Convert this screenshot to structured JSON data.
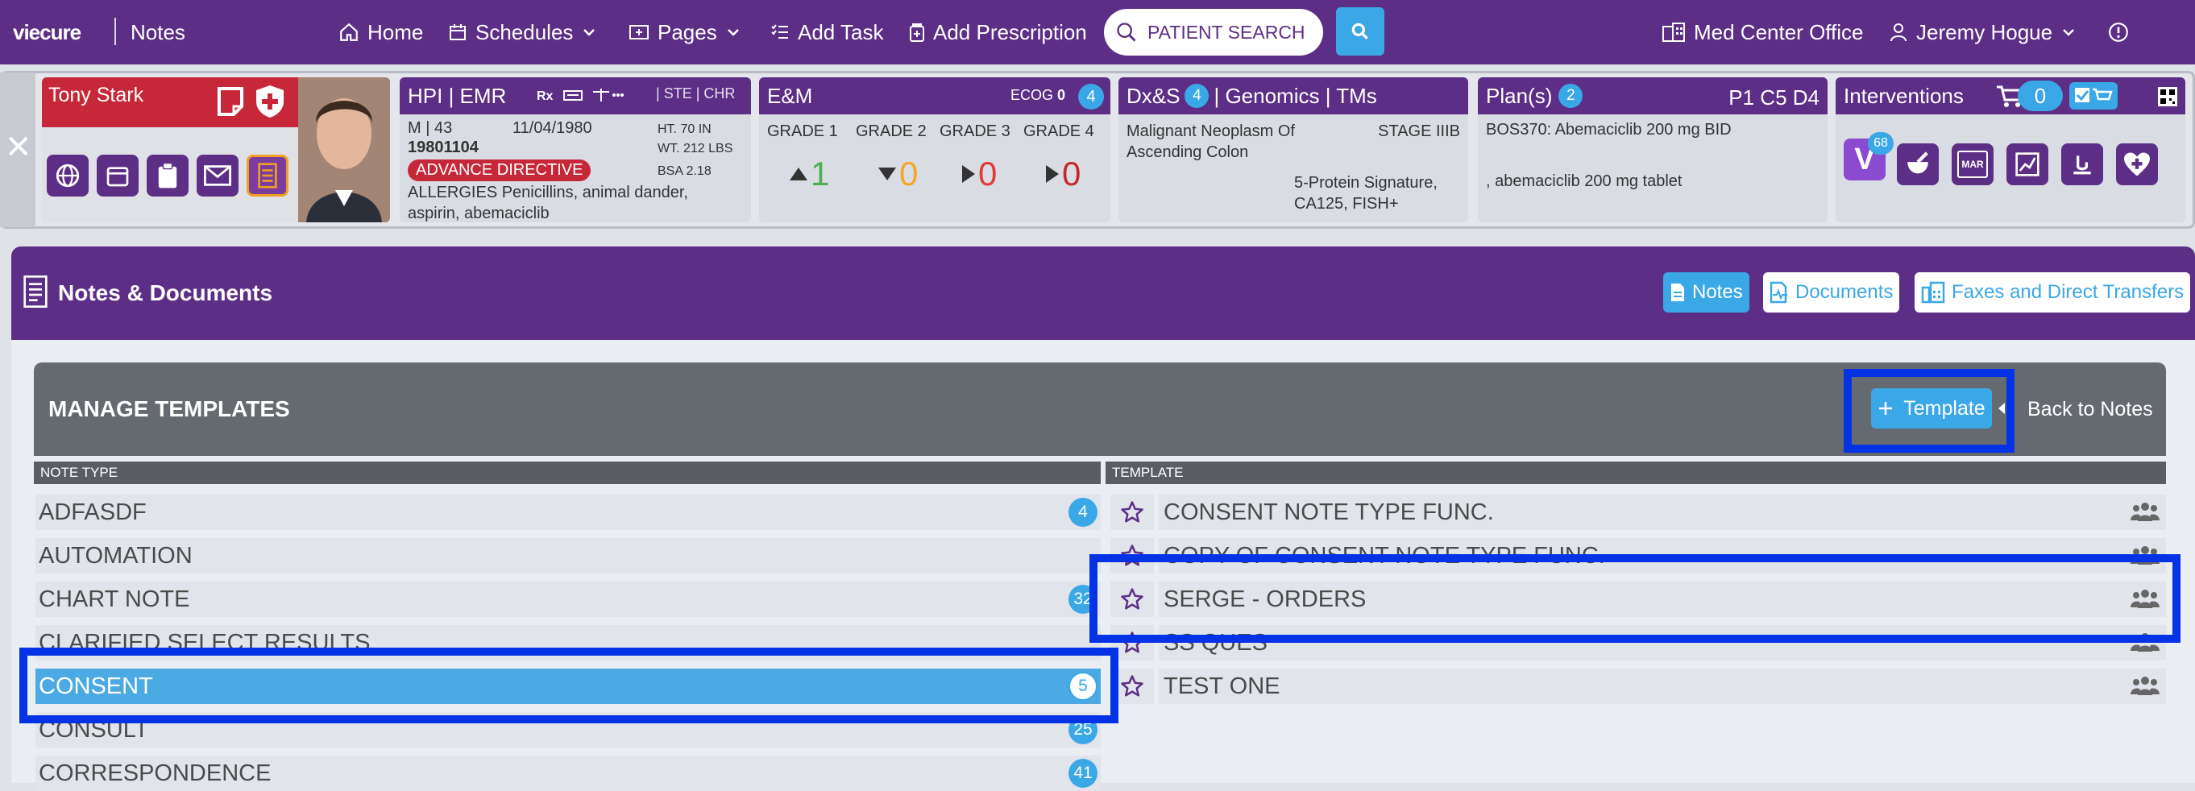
{
  "topnav": {
    "logo": "viecure",
    "section": "Notes",
    "home": "Home",
    "schedules": "Schedules",
    "pages": "Pages",
    "add_task": "Add Task",
    "add_prescription": "Add Prescription",
    "patient_search_placeholder": "PATIENT SEARCH",
    "office": "Med Center Office",
    "user": "Jeremy Hogue"
  },
  "patient": {
    "name": "Tony Stark",
    "sex_age": "M | 43",
    "mrn": "19801104",
    "dob": "11/04/1980",
    "height": "HT. 70 IN",
    "weight": "WT. 212 LBS",
    "bsa": "BSA 2.18",
    "advance_directive": "ADVANCE DIRECTIVE",
    "allergies": "ALLERGIES Penicillins, animal dander, aspirin, abemaciclib",
    "hpi_title": "HPI | EMR",
    "ste": "STE",
    "chr": "CHR"
  },
  "em": {
    "title": "E&M",
    "ecog_label": "ECOG",
    "ecog_value": "0",
    "badge": "4",
    "grades": [
      {
        "label": "GRADE 1",
        "value": "1",
        "color": "#4caf50"
      },
      {
        "label": "GRADE 2",
        "value": "0",
        "color": "#f5a623"
      },
      {
        "label": "GRADE 3",
        "value": "0",
        "color": "#e53935"
      },
      {
        "label": "GRADE 4",
        "value": "0",
        "color": "#c62828"
      }
    ]
  },
  "dx": {
    "title_a": "Dx&S",
    "badge": "4",
    "title_b": "| Genomics | TMs",
    "diagnosis": "Malignant Neoplasm Of Ascending Colon",
    "stage": "STAGE IIIB",
    "markers": "5-Protein Signature, CA125, FISH+"
  },
  "plans": {
    "title": "Plan(s)",
    "badge": "2",
    "cycle": "P1 C5 D4",
    "line1": "BOS370: Abemaciclib 200 mg BID",
    "line2": ", abemaciclib 200 mg tablet"
  },
  "interventions": {
    "title": "Interventions",
    "cart_count": "0",
    "v_badge": "68",
    "mar_label": "MAR"
  },
  "notes": {
    "title": "Notes & Documents",
    "tabs": [
      "Notes",
      "Documents",
      "Faxes and Direct Transfers"
    ]
  },
  "manage": {
    "title": "MANAGE TEMPLATES",
    "add_template": "Template",
    "back": "Back to Notes",
    "col_note_type": "NOTE TYPE",
    "col_template": "TEMPLATE"
  },
  "note_types": [
    {
      "name": "ADFASDF",
      "count": "4"
    },
    {
      "name": "AUTOMATION",
      "count": ""
    },
    {
      "name": "CHART NOTE",
      "count": "32"
    },
    {
      "name": "CLARIFIED SELECT RESULTS",
      "count": ""
    },
    {
      "name": "CONSENT",
      "count": "5"
    },
    {
      "name": "CONSULT",
      "count": "25"
    },
    {
      "name": "CORRESPONDENCE",
      "count": "41"
    }
  ],
  "templates": [
    {
      "name": "CONSENT NOTE TYPE FUNC."
    },
    {
      "name": "COPY OF CONSENT NOTE TYPE FUNC."
    },
    {
      "name": "SERGE - ORDERS"
    },
    {
      "name": "SS QUES"
    },
    {
      "name": "TEST ONE"
    }
  ]
}
